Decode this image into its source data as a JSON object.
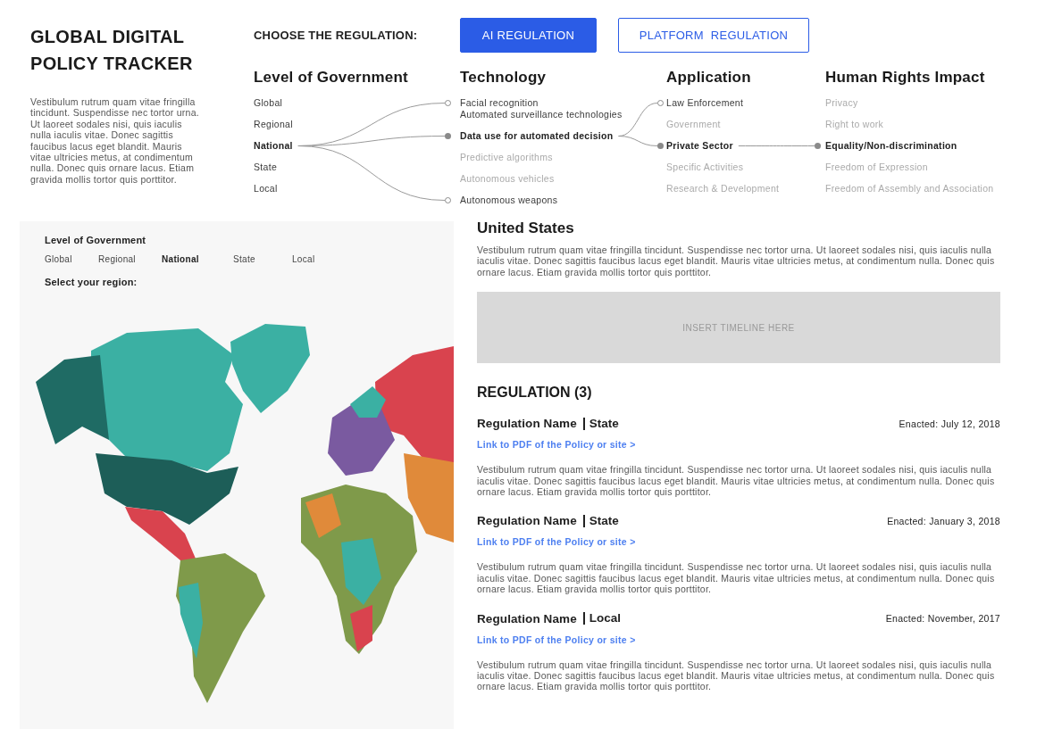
{
  "title_lines": [
    "GLOBAL DIGITAL",
    "POLICY TRACKER"
  ],
  "intro": "Vestibulum rutrum quam vitae fringilla tincidunt. Suspendisse nec tortor urna. Ut laoreet sodales nisi, quis iaculis nulla iaculis vitae. Donec sagittis faucibus lacus eget blandit. Mauris vitae ultricies metus, at condimentum nulla. Donec quis ornare lacus. Etiam gravida mollis tortor quis porttitor.",
  "chooser": {
    "label": "CHOOSE THE REGULATION:",
    "options": [
      {
        "label": "AI REGULATION",
        "selected": true
      },
      {
        "label": "PLATFORM  REGULATION",
        "selected": false
      }
    ]
  },
  "filters": {
    "columns": [
      {
        "heading": "Level of Government",
        "items": [
          {
            "label": "Global",
            "selected": false
          },
          {
            "label": "Regional",
            "selected": false
          },
          {
            "label": "National",
            "selected": true
          },
          {
            "label": "State",
            "selected": false
          },
          {
            "label": "Local",
            "selected": false
          }
        ]
      },
      {
        "heading": "Technology",
        "items": [
          {
            "label": "Facial recognition\nAutomated surveillance technologies",
            "selected": false,
            "linked": true,
            "dimmed": false
          },
          {
            "label": "Data use for automated decision",
            "selected": true,
            "linked": false,
            "dimmed": false
          },
          {
            "label": "Predictive algorithms",
            "selected": false,
            "linked": false,
            "dimmed": true
          },
          {
            "label": "Autonomous vehicles",
            "selected": false,
            "linked": false,
            "dimmed": true
          },
          {
            "label": "Autonomous weapons",
            "selected": false,
            "linked": true,
            "dimmed": false
          }
        ]
      },
      {
        "heading": "Application",
        "items": [
          {
            "label": "Law Enforcement",
            "selected": false,
            "linked": true,
            "dimmed": false
          },
          {
            "label": "Government",
            "selected": false,
            "linked": false,
            "dimmed": true
          },
          {
            "label": "Private Sector",
            "selected": true,
            "linked": false,
            "dimmed": false
          },
          {
            "label": "Specific Activities",
            "selected": false,
            "linked": false,
            "dimmed": true
          },
          {
            "label": "Research & Development",
            "selected": false,
            "linked": false,
            "dimmed": true
          }
        ]
      },
      {
        "heading": "Human Rights Impact",
        "items": [
          {
            "label": "Privacy",
            "selected": false,
            "linked": false,
            "dimmed": true
          },
          {
            "label": "Right to work",
            "selected": false,
            "linked": false,
            "dimmed": true
          },
          {
            "label": "Equality/Non-discrimination",
            "selected": true,
            "linked": false,
            "dimmed": false
          },
          {
            "label": "Freedom of Expression",
            "selected": false,
            "linked": false,
            "dimmed": true
          },
          {
            "label": "Freedom of Assembly and Association",
            "selected": false,
            "linked": false,
            "dimmed": true
          }
        ]
      }
    ]
  },
  "map_panel": {
    "heading": "Level of Government",
    "levels": [
      {
        "label": "Global",
        "selected": false
      },
      {
        "label": "Regional",
        "selected": false
      },
      {
        "label": "National",
        "selected": true
      },
      {
        "label": "State",
        "selected": false
      },
      {
        "label": "Local",
        "selected": false
      }
    ],
    "region_prompt": "Select your region:"
  },
  "detail": {
    "country": "United States",
    "description": "Vestibulum rutrum quam vitae fringilla tincidunt. Suspendisse nec tortor urna. Ut laoreet sodales nisi, quis iaculis nulla iaculis vitae. Donec sagittis faucibus lacus eget blandit. Mauris vitae ultricies metus, at condimentum nulla. Donec quis ornare lacus. Etiam gravida mollis tortor quis porttitor.",
    "timeline_placeholder": "INSERT TIMELINE HERE",
    "regulations_heading": "REGULATION (3)",
    "regulations": [
      {
        "name": "Regulation Name",
        "level": "State",
        "enacted": "Enacted: July 12, 2018",
        "link": "Link to PDF of the Policy or site >",
        "description": "Vestibulum rutrum quam vitae fringilla tincidunt. Suspendisse nec tortor urna. Ut laoreet sodales nisi, quis iaculis nulla iaculis vitae. Donec sagittis faucibus lacus eget blandit. Mauris vitae ultricies metus, at condimentum nulla. Donec quis ornare lacus. Etiam gravida mollis tortor quis porttitor."
      },
      {
        "name": "Regulation Name",
        "level": "State",
        "enacted": "Enacted: January 3, 2018",
        "link": "Link to PDF of the Policy or site >",
        "description": "Vestibulum rutrum quam vitae fringilla tincidunt. Suspendisse nec tortor urna. Ut laoreet sodales nisi, quis iaculis nulla iaculis vitae. Donec sagittis faucibus lacus eget blandit. Mauris vitae ultricies metus, at condimentum nulla. Donec quis ornare lacus. Etiam gravida mollis tortor quis porttitor."
      },
      {
        "name": "Regulation Name",
        "level": "Local",
        "enacted": "Enacted: November, 2017",
        "link": "Link to PDF of the Policy or site >",
        "description": "Vestibulum rutrum quam vitae fringilla tincidunt. Suspendisse nec tortor urna. Ut laoreet sodales nisi, quis iaculis nulla iaculis vitae. Donec sagittis faucibus lacus eget blandit. Mauris vitae ultricies metus, at condimentum nulla. Donec quis ornare lacus. Etiam gravida mollis tortor quis porttitor."
      }
    ]
  }
}
